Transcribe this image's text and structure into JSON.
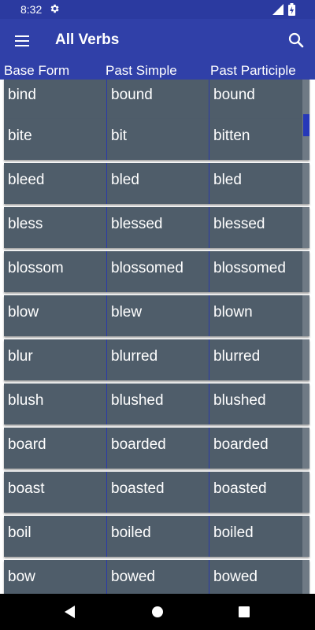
{
  "status": {
    "time": "8:32"
  },
  "appbar": {
    "title": "All Verbs"
  },
  "headers": {
    "base": "Base Form",
    "past": "Past Simple",
    "participle": "Past Participle"
  },
  "rows": [
    {
      "base": "bind",
      "past": "bound",
      "participle": "bound"
    },
    {
      "base": "bite",
      "past": "bit",
      "participle": "bitten"
    },
    {
      "base": "bleed",
      "past": "bled",
      "participle": "bled"
    },
    {
      "base": "bless",
      "past": "blessed",
      "participle": "blessed"
    },
    {
      "base": "blossom",
      "past": "blossomed",
      "participle": "blossomed"
    },
    {
      "base": "blow",
      "past": "blew",
      "participle": "blown"
    },
    {
      "base": "blur",
      "past": "blurred",
      "participle": "blurred"
    },
    {
      "base": "blush",
      "past": "blushed",
      "participle": "blushed"
    },
    {
      "base": "board",
      "past": "boarded",
      "participle": "boarded"
    },
    {
      "base": "boast",
      "past": "boasted",
      "participle": "boasted"
    },
    {
      "base": "boil",
      "past": "boiled",
      "participle": "boiled"
    },
    {
      "base": "bow",
      "past": "bowed",
      "participle": "bowed"
    }
  ],
  "icons": {
    "menu": "menu-icon",
    "search": "search-icon",
    "gear": "gear-icon",
    "back": "back-icon",
    "home": "home-icon",
    "recents": "recents-icon"
  },
  "colors": {
    "primary": "#3040a8",
    "row": "#4f5d6a",
    "statusbar": "#2b3aa0"
  }
}
